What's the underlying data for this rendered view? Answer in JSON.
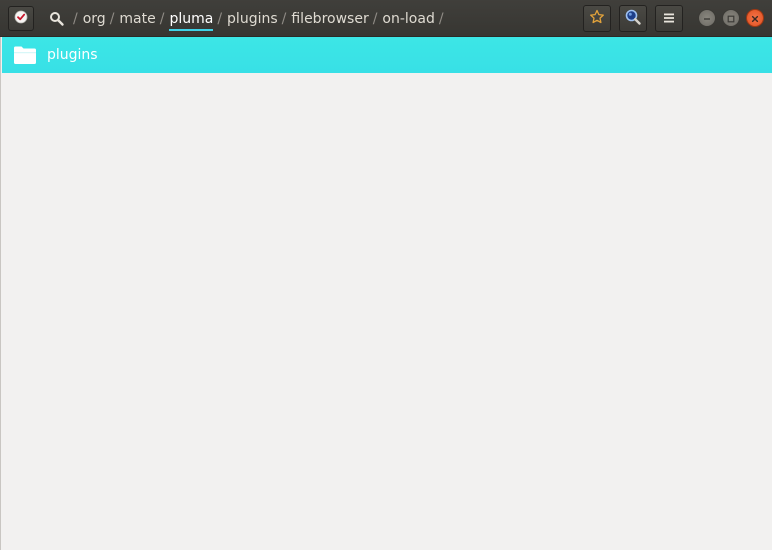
{
  "header": {
    "path": [
      {
        "label": "org",
        "active": false
      },
      {
        "label": "mate",
        "active": false
      },
      {
        "label": "pluma",
        "active": true
      },
      {
        "label": "plugins",
        "active": false
      },
      {
        "label": "filebrowser",
        "active": false
      },
      {
        "label": "on-load",
        "active": false
      }
    ],
    "separator": "/",
    "accent_color": "#3ed3e8"
  },
  "files": [
    {
      "name": "plugins",
      "icon": "folder-icon",
      "selected": true
    }
  ],
  "colors": {
    "headerbar": "#3c3b37",
    "selection": "#3ce6e6",
    "background": "#f2f1f0",
    "close_button": "#e0501f",
    "star_icon": "#e2a23b"
  }
}
